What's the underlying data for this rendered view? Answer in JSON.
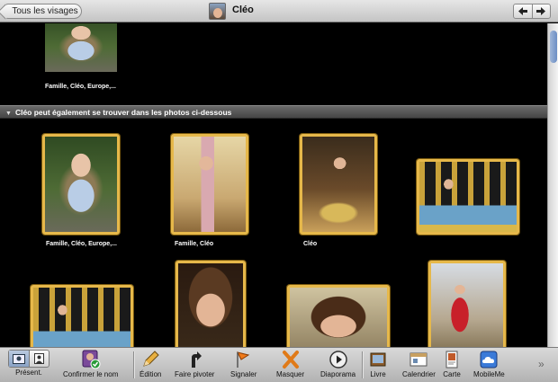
{
  "header": {
    "back_label": "Tous les visages",
    "title": "Cléo"
  },
  "top_photo": {
    "caption": "Famille, Cléo, Europe,..."
  },
  "section": {
    "label": "Cléo peut également se trouver dans les photos ci-dessous"
  },
  "photos_row1": [
    {
      "caption": "Famille, Cléo, Europe,..."
    },
    {
      "caption": "Famille, Cléo"
    },
    {
      "caption": "Cléo"
    },
    {
      "caption": ""
    }
  ],
  "toolbar": {
    "present_label": "Présent.",
    "confirm_label": "Confirmer le nom",
    "edit_label": "Édition",
    "rotate_label": "Faire pivoter",
    "flag_label": "Signaler",
    "hide_label": "Masquer",
    "slideshow_label": "Diaporama",
    "book_label": "Livre",
    "calendar_label": "Calendrier",
    "card_label": "Carte",
    "mobileme_label": "MobileMe",
    "more_label": "»"
  },
  "colors": {
    "selection_border": "#e6b84a",
    "background": "#000000"
  }
}
